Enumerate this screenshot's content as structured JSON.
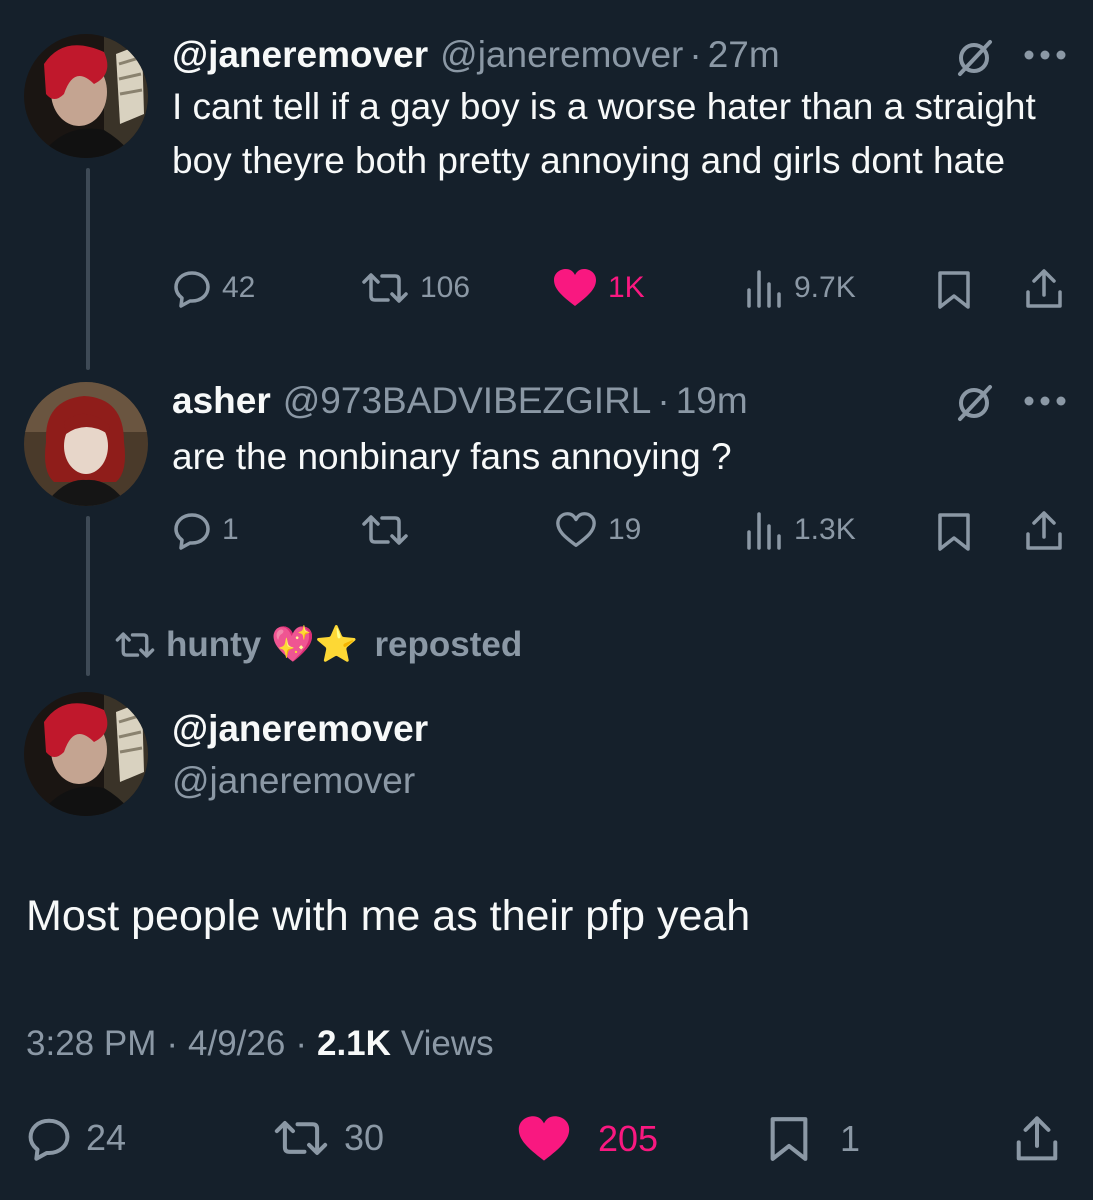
{
  "tweet1": {
    "display_name": "@janeremover",
    "handle": "@janeremover",
    "sep": "·",
    "time": "27m",
    "text": "I cant tell if a gay boy is a worse hater than a straight boy theyre both pretty annoying and girls dont hate",
    "replies": "42",
    "reposts": "106",
    "likes": "1K",
    "views": "9.7K",
    "liked": true
  },
  "tweet2": {
    "display_name": "asher",
    "handle": "@973BADVIBEZGIRL",
    "sep": "·",
    "time": "19m",
    "text": "are the nonbinary fans annoying ?",
    "replies": "1",
    "reposts": "",
    "likes": "19",
    "views": "1.3K",
    "liked": false
  },
  "repost_banner": {
    "user": "hunty",
    "emojis": "💖⭐",
    "suffix": "reposted"
  },
  "main": {
    "display_name": "@janeremover",
    "handle": "@janeremover",
    "text": "Most people with me as their pfp yeah",
    "time": "3:28 PM",
    "sep1": "·",
    "date": "4/9/26",
    "sep2": "·",
    "views_count": "2.1K",
    "views_label": "Views",
    "replies": "24",
    "reposts": "30",
    "likes": "205",
    "bookmarks": "1"
  },
  "colors": {
    "background": "#15202b",
    "text": "#f7f9f9",
    "muted": "#8b98a5",
    "like": "#f91880"
  },
  "icons": [
    "reply-icon",
    "repost-icon",
    "heart-icon",
    "views-icon",
    "bookmark-icon",
    "share-icon",
    "no-grok-icon",
    "more-icon"
  ]
}
